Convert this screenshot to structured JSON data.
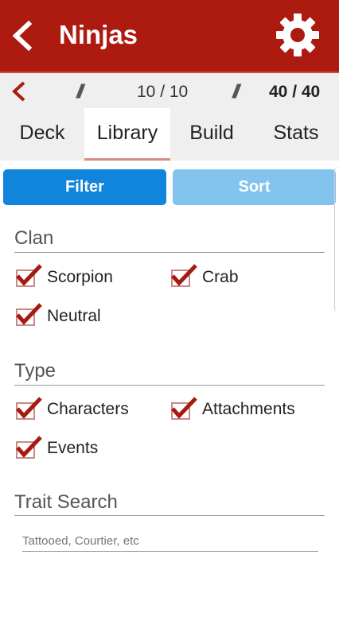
{
  "appbar": {
    "title": "Ninjas"
  },
  "counter": {
    "left_count": "10 / 10",
    "right_count": "40 / 40",
    "separator": "//"
  },
  "tabs": [
    {
      "label": "Deck",
      "active": false
    },
    {
      "label": "Library",
      "active": true
    },
    {
      "label": "Build",
      "active": false
    },
    {
      "label": "Stats",
      "active": false
    }
  ],
  "buttons": {
    "filter": "Filter",
    "sort": "Sort"
  },
  "clan": {
    "title": "Clan",
    "options": [
      {
        "label": "Scorpion",
        "checked": true
      },
      {
        "label": "Crab",
        "checked": true
      },
      {
        "label": "Neutral",
        "checked": true
      }
    ]
  },
  "type": {
    "title": "Type",
    "options": [
      {
        "label": "Characters",
        "checked": true
      },
      {
        "label": "Attachments",
        "checked": true
      },
      {
        "label": "Events",
        "checked": true
      }
    ]
  },
  "trait_search": {
    "title": "Trait Search",
    "placeholder": "Tattooed, Courtier, etc",
    "value": ""
  },
  "colors": {
    "brand": "#ac1a10",
    "filter_button": "#1185dc",
    "sort_button": "#83c4ee",
    "check": "#a51a12"
  }
}
